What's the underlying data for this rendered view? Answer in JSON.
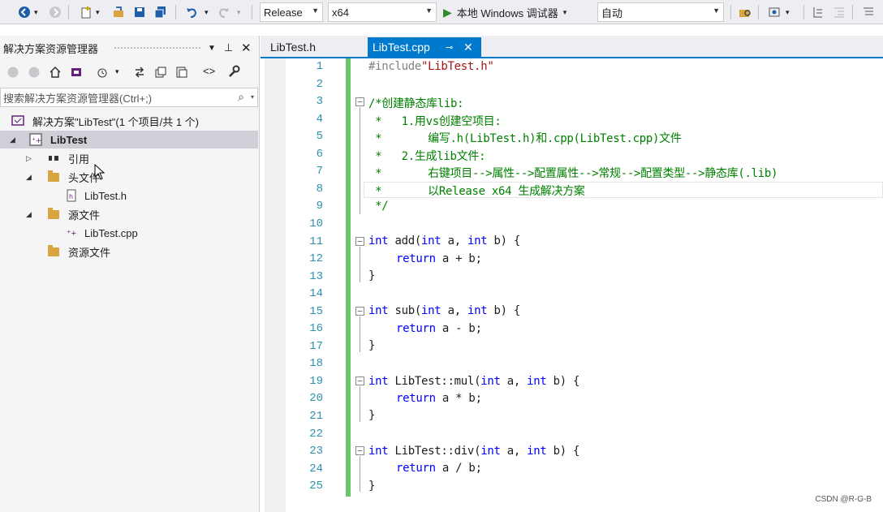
{
  "toolbar": {
    "config_value": "Release",
    "platform_value": "x64",
    "run_label": "本地 Windows 调试器",
    "run_mode_value": "自动"
  },
  "solution_explorer": {
    "title": "解决方案资源管理器",
    "search_placeholder": "搜索解决方案资源管理器(Ctrl+;)",
    "tree": [
      {
        "label": "解决方案\"LibTest\"(1 个项目/共 1 个)"
      },
      {
        "label": "LibTest"
      },
      {
        "label": "引用"
      },
      {
        "label": "头文件"
      },
      {
        "label": "LibTest.h"
      },
      {
        "label": "源文件"
      },
      {
        "label": "LibTest.cpp"
      },
      {
        "label": "资源文件"
      }
    ]
  },
  "tabs": [
    {
      "label": "LibTest.h"
    },
    {
      "label": "LibTest.cpp"
    }
  ],
  "editor": {
    "line_numbers": [
      "1",
      "2",
      "3",
      "4",
      "5",
      "6",
      "7",
      "8",
      "9",
      "10",
      "11",
      "12",
      "13",
      "14",
      "15",
      "16",
      "17",
      "18",
      "19",
      "20",
      "21",
      "22",
      "23",
      "24",
      "25"
    ],
    "code": {
      "l1_a": "#include",
      "l1_b": "\"LibTest.h\"",
      "l3": "/*创建静态库lib:",
      "l4": " *   1.用vs创建空项目:",
      "l5": " *       编写.h(LibTest.h)和.cpp(LibTest.cpp)文件",
      "l6": " *   2.生成lib文件:",
      "l7": " *       右键项目-->属性-->配置属性-->常规-->配置类型-->静态库(.lib)",
      "l8": " *       以Release x64 生成解决方案",
      "l9": " */",
      "l11_sig": " add(",
      "l11_a": " a, ",
      "l11_b": " b) {",
      "l12": "a + b;",
      "l13": "}",
      "l15_sig": " sub(",
      "l15_a": " a, ",
      "l15_b": " b) {",
      "l16": "a - b;",
      "l17": "}",
      "l19_sig": " LibTest::mul(",
      "l19_a": " a, ",
      "l19_b": " b) {",
      "l20": "a * b;",
      "l21": "}",
      "l23_sig": " LibTest::div(",
      "l23_a": " a, ",
      "l23_b": " b) {",
      "l24": "a / b;",
      "l25": "}",
      "kw_int": "int",
      "kw_return": "return"
    }
  },
  "watermark": "CSDN @R-G-B"
}
